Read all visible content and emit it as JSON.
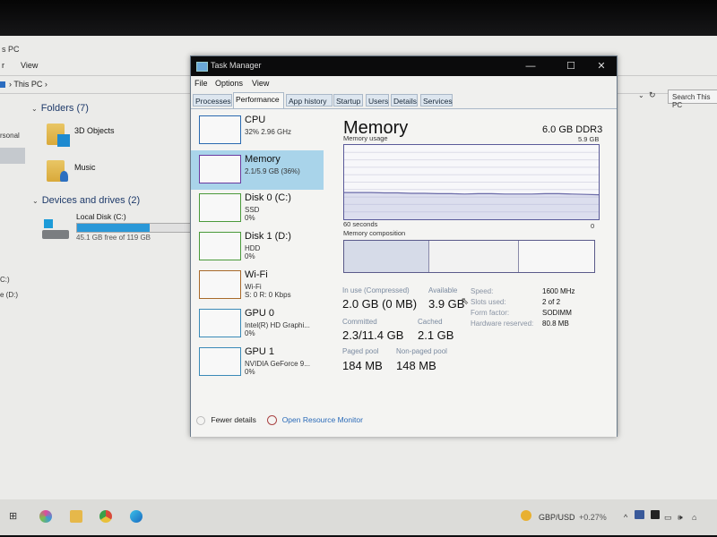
{
  "explorer": {
    "title": "s PC",
    "menu": [
      "r",
      "View"
    ],
    "breadcrumb": [
      "This PC"
    ],
    "search_placeholder": "Search This PC",
    "nav_left": [
      "rsonal",
      "C:)",
      "e (D:)"
    ],
    "folders_header": "Folders (7)",
    "folders": [
      {
        "name": "3D Objects",
        "icon": "3d-objects-folder-icon"
      },
      {
        "name": "Music",
        "icon": "music-folder-icon"
      }
    ],
    "devices_header": "Devices and drives (2)",
    "drives": [
      {
        "name": "Local Disk (C:)",
        "free_text": "45.1 GB free of 119 GB",
        "used_fraction": 0.62
      }
    ]
  },
  "task_manager": {
    "title": "Task Manager",
    "window_buttons": {
      "minimize": "—",
      "maximize": "☐",
      "close": "✕"
    },
    "menu": [
      "File",
      "Options",
      "View"
    ],
    "tabs": [
      "Processes",
      "Performance",
      "App history",
      "Startup",
      "Users",
      "Details",
      "Services"
    ],
    "active_tab": "Performance",
    "sidebar": [
      {
        "name": "CPU",
        "line1": "32%  2.96 GHz",
        "line2": "",
        "color": "#2a6ab0"
      },
      {
        "name": "Memory",
        "line1": "2.1/5.9 GB (36%)",
        "line2": "",
        "color": "#6a3aa0",
        "selected": true
      },
      {
        "name": "Disk 0 (C:)",
        "line1": "SSD",
        "line2": "0%",
        "color": "#4a9a3a"
      },
      {
        "name": "Disk 1 (D:)",
        "line1": "HDD",
        "line2": "0%",
        "color": "#4a9a3a"
      },
      {
        "name": "Wi-Fi",
        "line1": "Wi-Fi",
        "line2": "S: 0  R: 0 Kbps",
        "color": "#a86a2a"
      },
      {
        "name": "GPU 0",
        "line1": "Intel(R) HD Graphi...",
        "line2": "0%",
        "color": "#3a8ab8"
      },
      {
        "name": "GPU 1",
        "line1": "NVIDIA GeForce 9...",
        "line2": "0%",
        "color": "#3a8ab8"
      }
    ],
    "memory": {
      "title": "Memory",
      "capacity": "6.0 GB DDR3",
      "usage_label": "Memory usage",
      "usage_max": "5.9 GB",
      "time_left": "60 seconds",
      "time_right": "0",
      "composition_label": "Memory composition",
      "usage_history_fraction": [
        0.36,
        0.36,
        0.36,
        0.355,
        0.355,
        0.35,
        0.35,
        0.345,
        0.345,
        0.34,
        0.345,
        0.345,
        0.34,
        0.34,
        0.34,
        0.345,
        0.345,
        0.34,
        0.335,
        0.33
      ],
      "composition_fractions": {
        "in_use": 0.34,
        "modified": 0.0,
        "standby": 0.36,
        "free": 0.3
      },
      "stats": {
        "in_use_label": "In use (Compressed)",
        "in_use": "2.0 GB (0 MB)",
        "available_label": "Available",
        "available": "3.9 GB",
        "committed_label": "Committed",
        "committed": "2.3/11.4 GB",
        "cached_label": "Cached",
        "cached": "2.1 GB",
        "paged_label": "Paged pool",
        "paged": "184 MB",
        "nonpaged_label": "Non-paged pool",
        "nonpaged": "148 MB"
      },
      "details": [
        {
          "k": "Speed:",
          "v": "1600 MHz"
        },
        {
          "k": "Slots used:",
          "v": "2 of 2"
        },
        {
          "k": "Form factor:",
          "v": "SODIMM"
        },
        {
          "k": "Hardware reserved:",
          "v": "80.8 MB"
        }
      ]
    },
    "footer": {
      "fewer_details": "Fewer details",
      "open_resource_monitor": "Open Resource Monitor"
    }
  },
  "taskbar": {
    "ticker": "GBP/USD",
    "ticker_change": "+0.27%"
  },
  "colors": {
    "accent_selected": "#a9d4ea",
    "memory_line": "#6a6aa8",
    "link": "#2a6ab8"
  }
}
